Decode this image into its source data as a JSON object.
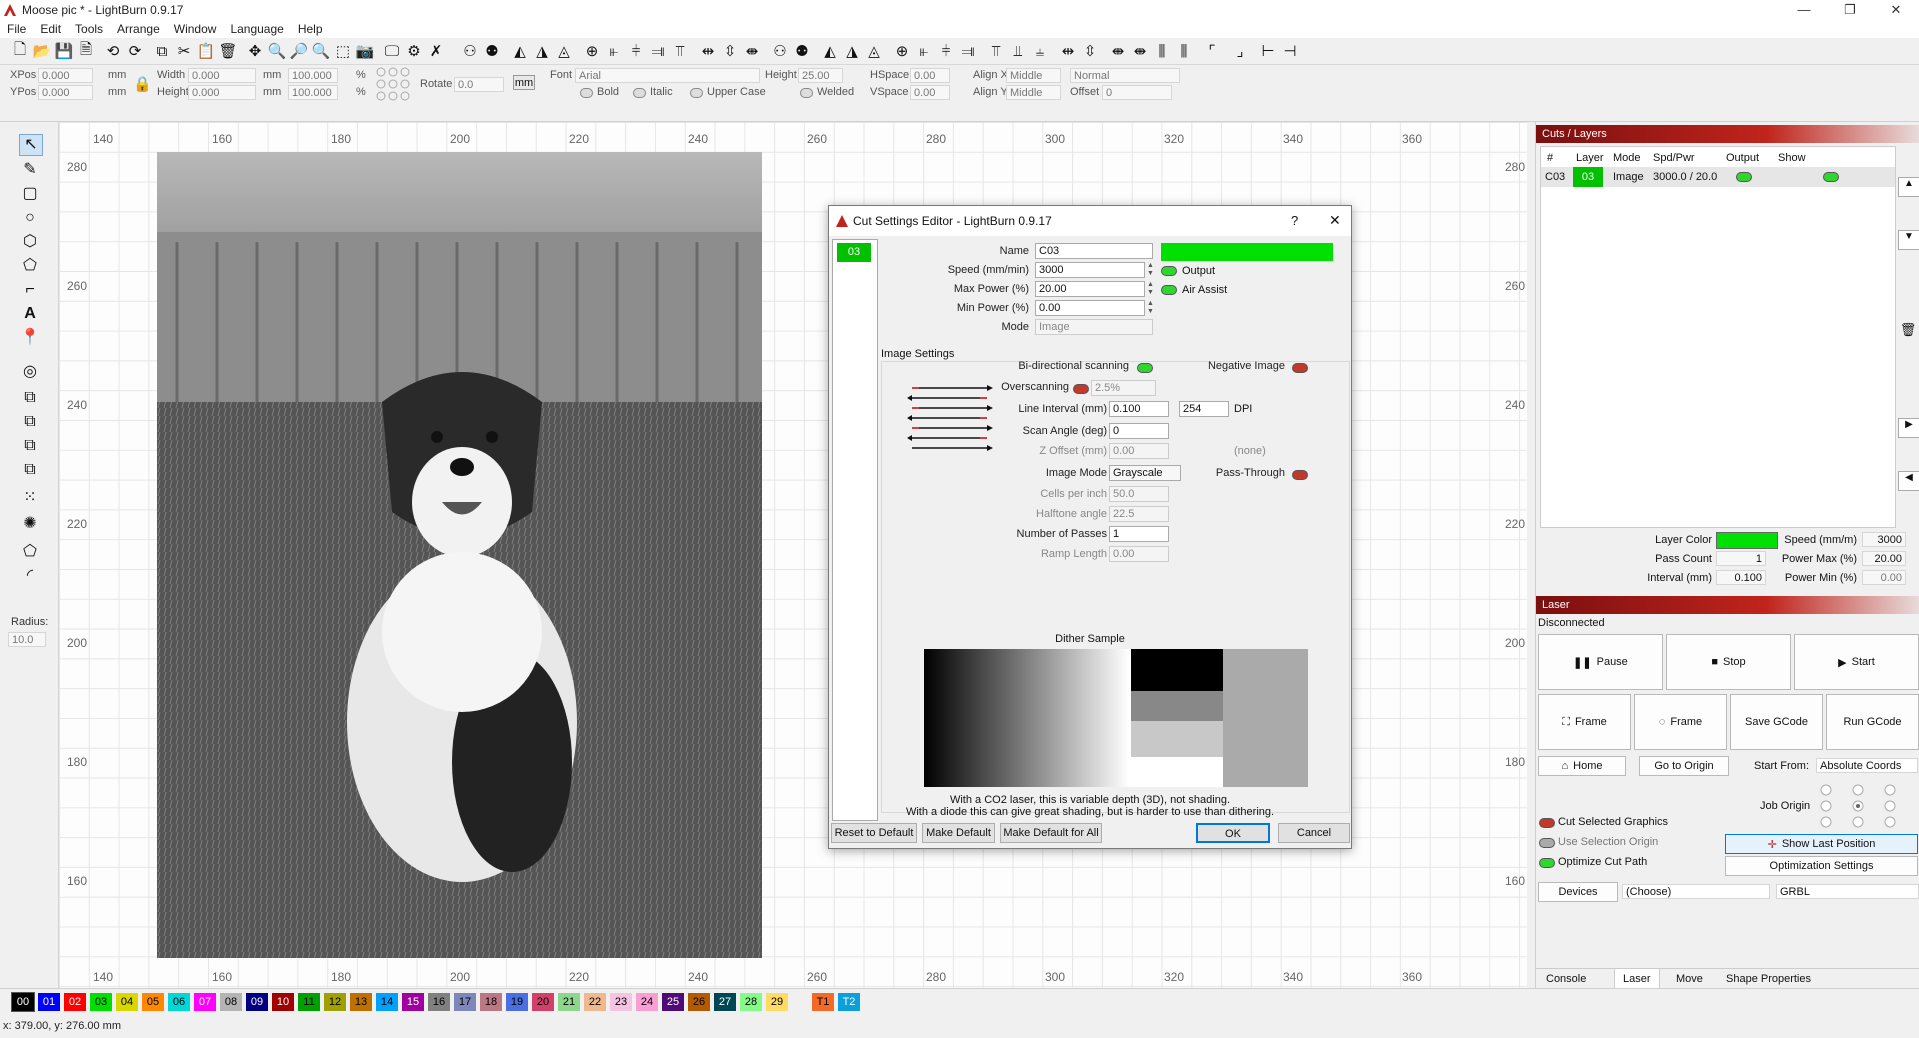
{
  "window": {
    "title": "Moose pic * - LightBurn 0.9.17",
    "minimize": "—",
    "restore": "❐",
    "close": "✕"
  },
  "menu": [
    "File",
    "Edit",
    "Tools",
    "Arrange",
    "Window",
    "Language",
    "Help"
  ],
  "props": {
    "xpos_label": "XPos",
    "xpos": "0.000",
    "ypos_label": "YPos",
    "ypos": "0.000",
    "unit_mm": "mm",
    "width_label": "Width",
    "width": "0.000",
    "height_label": "Height",
    "height": "0.000",
    "wpct": "100.000",
    "hpct": "100.000",
    "pct": "%",
    "rotate_label": "Rotate",
    "rotate": "0.0",
    "mm_btn": "mm",
    "font_label": "Font",
    "font": "Arial",
    "fheight_label": "Height",
    "fheight": "25.00",
    "hspace_label": "HSpace",
    "hspace": "0.00",
    "vspace_label": "VSpace",
    "vspace": "0.00",
    "alignx_label": "Align X",
    "alignx": "Middle",
    "aligny_label": "Align Y",
    "aligny": "Middle",
    "normal": "Normal",
    "offset_label": "Offset",
    "offset": "0",
    "bold": "Bold",
    "italic": "Italic",
    "upper": "Upper Case",
    "welded": "Welded"
  },
  "left": {
    "radius_label": "Radius:",
    "radius": "10.0"
  },
  "rulers": {
    "top": [
      "140",
      "160",
      "180",
      "200",
      "220",
      "240",
      "260",
      "280",
      "300",
      "320",
      "340",
      "360"
    ],
    "left": [
      "280",
      "260",
      "240",
      "220",
      "200",
      "180",
      "160"
    ]
  },
  "dialog": {
    "title": "Cut Settings Editor - LightBurn 0.9.17",
    "help": "?",
    "close": "✕",
    "layer_chip": "03",
    "name_label": "Name",
    "name": "C03",
    "speed_label": "Speed (mm/min)",
    "speed": "3000",
    "maxp_label": "Max Power (%)",
    "maxp": "20.00",
    "minp_label": "Min Power (%)",
    "minp": "0.00",
    "mode_label": "Mode",
    "mode": "Image",
    "output": "Output",
    "air": "Air Assist",
    "image_settings": "Image Settings",
    "bidir": "Bi-directional scanning",
    "negative": "Negative Image",
    "overscan": "Overscanning",
    "overscan_val": "2.5%",
    "interval_label": "Line Interval (mm)",
    "interval": "0.100",
    "dpi": "254",
    "dpi_label": "DPI",
    "scanangle_label": "Scan Angle (deg)",
    "scanangle": "0",
    "zoffset_label": "Z Offset (mm)",
    "zoffset": "0.00",
    "none": "(none)",
    "imagemode_label": "Image Mode",
    "imagemode": "Grayscale",
    "passthrough": "Pass-Through",
    "cells_label": "Cells per inch",
    "cells": "50.0",
    "halftone_label": "Halftone angle",
    "halftone": "22.5",
    "passes_label": "Number of Passes",
    "passes": "1",
    "ramp_label": "Ramp Length",
    "ramp": "0.00",
    "dither_title": "Dither Sample",
    "note1": "With a CO2 laser, this is variable depth (3D), not shading.",
    "note2": "With a diode this can give great shading, but is harder to use than dithering.",
    "reset": "Reset to Default",
    "makedef": "Make Default",
    "makedefall": "Make Default for All",
    "ok": "OK",
    "cancel": "Cancel"
  },
  "cuts": {
    "title": "Cuts / Layers",
    "headers": [
      "#",
      "Layer",
      "Mode",
      "Spd/Pwr",
      "Output",
      "Show"
    ],
    "row": {
      "num": "C03",
      "layer": "03",
      "mode": "Image",
      "spdpwr": "3000.0 / 20.0"
    },
    "layer_color_label": "Layer Color",
    "speed_label": "Speed (mm/m)",
    "speed": "3000",
    "pass_label": "Pass Count",
    "pass": "1",
    "pmax_label": "Power Max (%)",
    "pmax": "20.00",
    "interval_label": "Interval (mm)",
    "interval": "0.100",
    "pmin_label": "Power Min (%)",
    "pmin": "0.00"
  },
  "laser": {
    "title": "Laser",
    "status": "Disconnected",
    "pause": "Pause",
    "stop": "Stop",
    "start": "Start",
    "frame1": "Frame",
    "frame2": "Frame",
    "savegcode": "Save GCode",
    "rungcode": "Run GCode",
    "home": "Home",
    "origin": "Go to Origin",
    "startfrom_label": "Start From:",
    "startfrom": "Absolute Coords",
    "joborigin": "Job Origin",
    "cutsel": "Cut Selected Graphics",
    "usesel": "Use Selection Origin",
    "optimize": "Optimize Cut Path",
    "showlast": "Show Last Position",
    "optsettings": "Optimization Settings",
    "devices": "Devices",
    "choose": "(Choose)",
    "grbl": "GRBL"
  },
  "tabs": [
    "Console",
    "Laser",
    "Move",
    "Shape Properties"
  ],
  "palette": [
    {
      "l": "00",
      "c": "#000000",
      "t": "#ffffff"
    },
    {
      "l": "01",
      "c": "#0000ff",
      "t": "#ffffff"
    },
    {
      "l": "02",
      "c": "#ff0000",
      "t": "#ffffff"
    },
    {
      "l": "03",
      "c": "#00e000",
      "t": "#000000"
    },
    {
      "l": "04",
      "c": "#d8d800",
      "t": "#000000"
    },
    {
      "l": "05",
      "c": "#ff8800",
      "t": "#000000"
    },
    {
      "l": "06",
      "c": "#00d8d8",
      "t": "#000000"
    },
    {
      "l": "07",
      "c": "#ff00ff",
      "t": "#ffffff"
    },
    {
      "l": "08",
      "c": "#b4b4b4",
      "t": "#000000"
    },
    {
      "l": "09",
      "c": "#000080",
      "t": "#ffffff"
    },
    {
      "l": "10",
      "c": "#a00000",
      "t": "#ffffff"
    },
    {
      "l": "11",
      "c": "#00a000",
      "t": "#000000"
    },
    {
      "l": "12",
      "c": "#a0a000",
      "t": "#000000"
    },
    {
      "l": "13",
      "c": "#c07000",
      "t": "#000000"
    },
    {
      "l": "14",
      "c": "#00a0ff",
      "t": "#000000"
    },
    {
      "l": "15",
      "c": "#a000a0",
      "t": "#ffffff"
    },
    {
      "l": "16",
      "c": "#808080",
      "t": "#000000"
    },
    {
      "l": "17",
      "c": "#7d87b9",
      "t": "#000000"
    },
    {
      "l": "18",
      "c": "#bb7784",
      "t": "#000000"
    },
    {
      "l": "19",
      "c": "#4a6fe3",
      "t": "#000000"
    },
    {
      "l": "20",
      "c": "#d33f6a",
      "t": "#000000"
    },
    {
      "l": "21",
      "c": "#8cd78c",
      "t": "#000000"
    },
    {
      "l": "22",
      "c": "#f0b98d",
      "t": "#000000"
    },
    {
      "l": "23",
      "c": "#f6c4e1",
      "t": "#000000"
    },
    {
      "l": "24",
      "c": "#fa9ed4",
      "t": "#000000"
    },
    {
      "l": "25",
      "c": "#500a78",
      "t": "#ffffff"
    },
    {
      "l": "26",
      "c": "#b45a00",
      "t": "#000000"
    },
    {
      "l": "27",
      "c": "#004754",
      "t": "#ffffff"
    },
    {
      "l": "28",
      "c": "#86fa88",
      "t": "#000000"
    },
    {
      "l": "29",
      "c": "#ffdb66",
      "t": "#000000"
    },
    {
      "l": "T1",
      "c": "#f36926",
      "t": "#000000"
    },
    {
      "l": "T2",
      "c": "#0aa0dc",
      "t": "#ffffff"
    }
  ],
  "status": {
    "coords": "x: 379.00, y: 276.00 mm"
  }
}
